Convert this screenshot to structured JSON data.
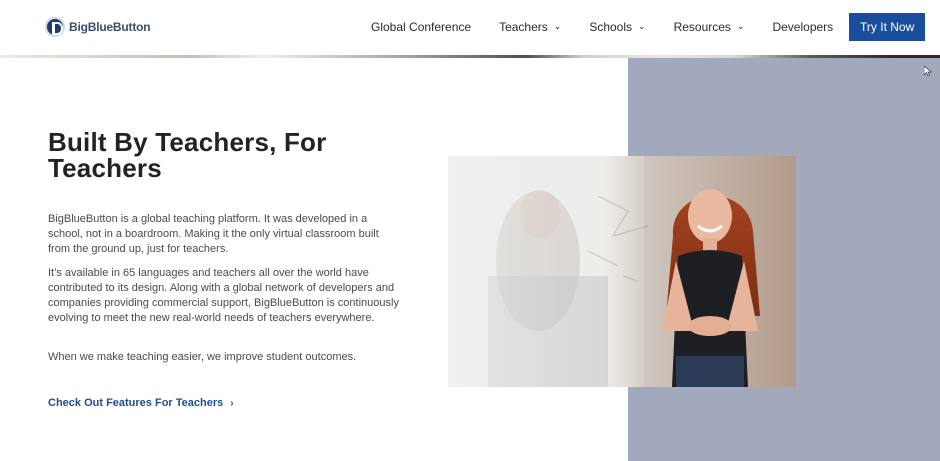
{
  "header": {
    "logo_text": "BigBlueButton",
    "nav": [
      {
        "label": "Global Conference",
        "has_dropdown": false
      },
      {
        "label": "Teachers",
        "has_dropdown": true
      },
      {
        "label": "Schools",
        "has_dropdown": true
      },
      {
        "label": "Resources",
        "has_dropdown": true
      },
      {
        "label": "Developers",
        "has_dropdown": false
      }
    ],
    "cta_label": "Try It Now"
  },
  "main": {
    "heading": "Built By Teachers, For Teachers",
    "paragraphs": [
      "BigBlueButton is a global teaching platform. It was developed in a school, not in a boardroom. Making it the only virtual classroom built from the ground up, just for teachers.",
      "It’s available in 65 languages and teachers all over the world have contributed to its design. Along with a global network of developers and companies providing commercial support, BigBlueButton is continuously evolving to meet the new real-world needs of teachers everywhere.",
      "When we make teaching easier, we improve student outcomes."
    ],
    "link_label": "Check Out Features For Teachers"
  },
  "colors": {
    "accent": "#1a4e9c",
    "panel": "#a3a9bc",
    "link": "#1d4f8f"
  },
  "icons": {
    "logo": "bigbluebutton-logo-icon",
    "dropdown": "chevron-down-icon",
    "link_arrow": "chevron-right-icon"
  }
}
